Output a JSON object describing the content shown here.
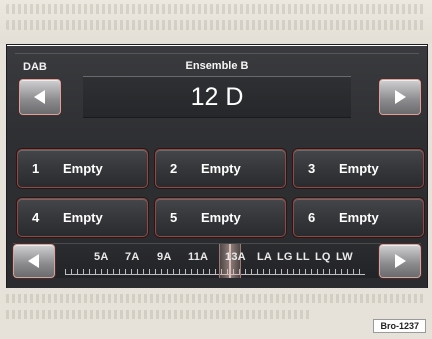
{
  "radio": {
    "band": "DAB",
    "ensemble": "Ensemble B",
    "station": "12 D"
  },
  "presets": [
    {
      "num": "1",
      "label": "Empty"
    },
    {
      "num": "2",
      "label": "Empty"
    },
    {
      "num": "3",
      "label": "Empty"
    },
    {
      "num": "4",
      "label": "Empty"
    },
    {
      "num": "5",
      "label": "Empty"
    },
    {
      "num": "6",
      "label": "Empty"
    }
  ],
  "channel_scale": {
    "channels": [
      "5A",
      "7A",
      "9A",
      "11A",
      "13A",
      "LA",
      "LG",
      "LL",
      "LQ",
      "LW"
    ]
  },
  "icons": {
    "prev": "left-arrow-icon",
    "next": "right-arrow-icon"
  },
  "figure_id": "Bro-1237"
}
